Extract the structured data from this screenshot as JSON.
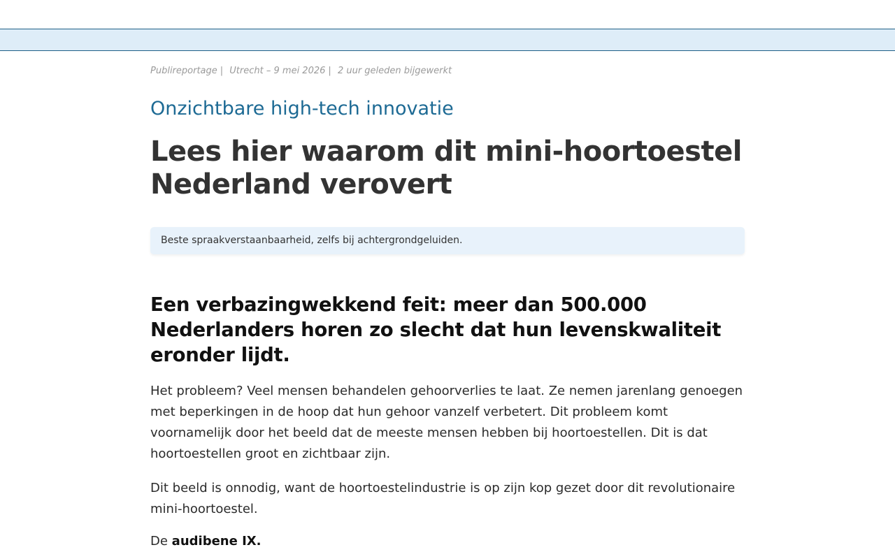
{
  "meta": {
    "category": "Publireportage",
    "location_date": "Utrecht – 9 mei 2026",
    "updated": "2 uur geleden bijgewerkt",
    "separator": "|"
  },
  "article": {
    "kicker": "Onzichtbare high-tech innovatie",
    "headline": "Lees hier waarom dit mini-hoortoestel Nederland verovert",
    "callout": "Beste spraakverstaanbaarheid, zelfs bij achtergrondgeluiden.",
    "subhead": "Een verbazingwekkend feit: meer dan 500.000 Nederlanders horen zo slecht dat hun levenskwaliteit eronder lijdt.",
    "paragraphs": [
      "Het probleem? Veel mensen behandelen gehoorverlies te laat. Ze nemen jarenlang genoegen met beperkingen in de hoop dat hun gehoor vanzelf verbetert. Dit probleem komt voornamelijk door het beeld dat de meeste mensen hebben bij hoortoestellen. Dit is dat hoortoestellen groot en zichtbaar zijn.",
      "Dit beeld is onnodig, want de hoortoestelindustrie is op zijn kop gezet door dit revolutionaire mini-hoortoestel."
    ],
    "product_intro": "De",
    "product_name": "audibene IX."
  },
  "colors": {
    "nav_band": "#deedf8",
    "nav_border": "#1f5f87",
    "kicker": "#1d6a94",
    "callout_bg": "#e8f2fb"
  }
}
